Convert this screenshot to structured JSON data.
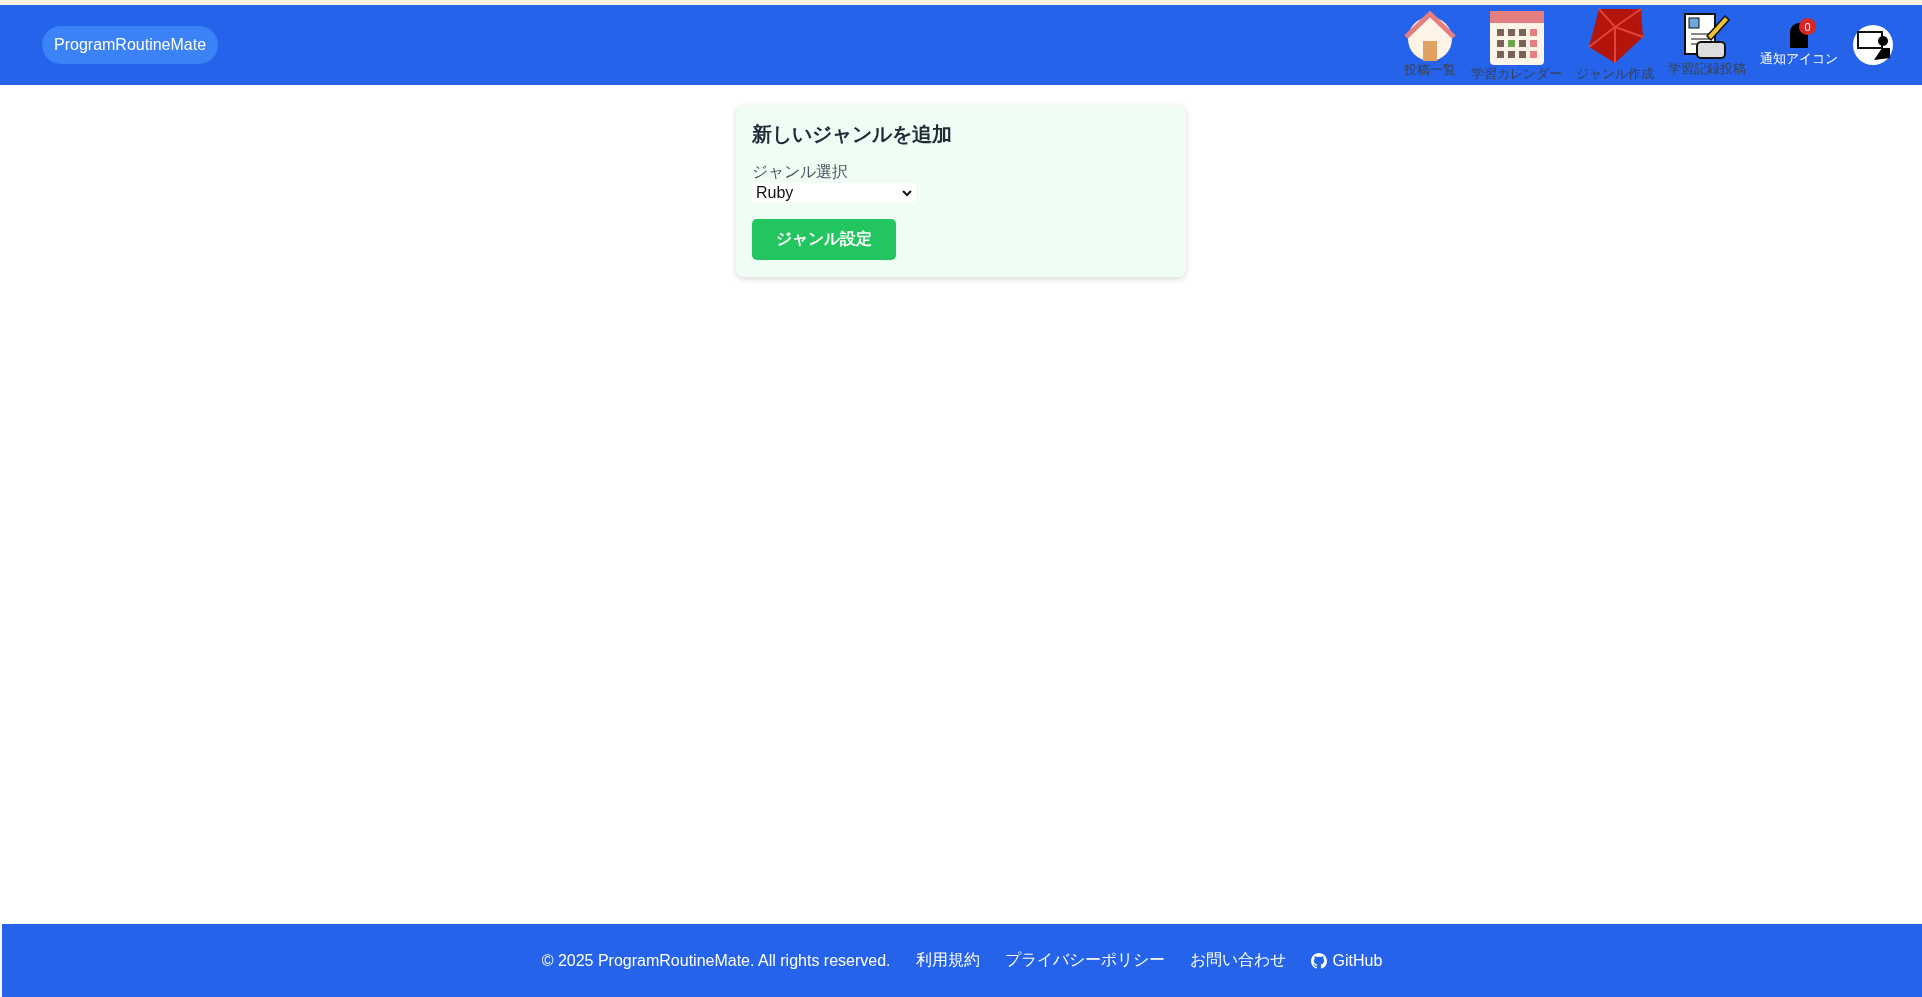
{
  "header": {
    "logo": "ProgramRoutineMate",
    "nav": [
      {
        "kind": "home",
        "label": "投稿一覧"
      },
      {
        "kind": "calendar",
        "label": "学習カレンダー"
      },
      {
        "kind": "gem",
        "label": "ジャンル作成"
      },
      {
        "kind": "document",
        "label": "学習記録投稿"
      },
      {
        "kind": "bell",
        "label": "通知アイコン",
        "badge": "0"
      },
      {
        "kind": "avatar"
      }
    ]
  },
  "form": {
    "title": "新しいジャンルを追加",
    "field_label": "ジャンル選択",
    "select_value": "Ruby",
    "submit": "ジャンル設定"
  },
  "footer": {
    "copyright": "© 2025 ProgramRoutineMate. All rights reserved.",
    "links": [
      {
        "kind": "text",
        "label": "利用規約"
      },
      {
        "kind": "text",
        "label": "プライバシーポリシー"
      },
      {
        "kind": "text",
        "label": "お問い合わせ"
      },
      {
        "kind": "github",
        "label": "GitHub"
      }
    ]
  }
}
